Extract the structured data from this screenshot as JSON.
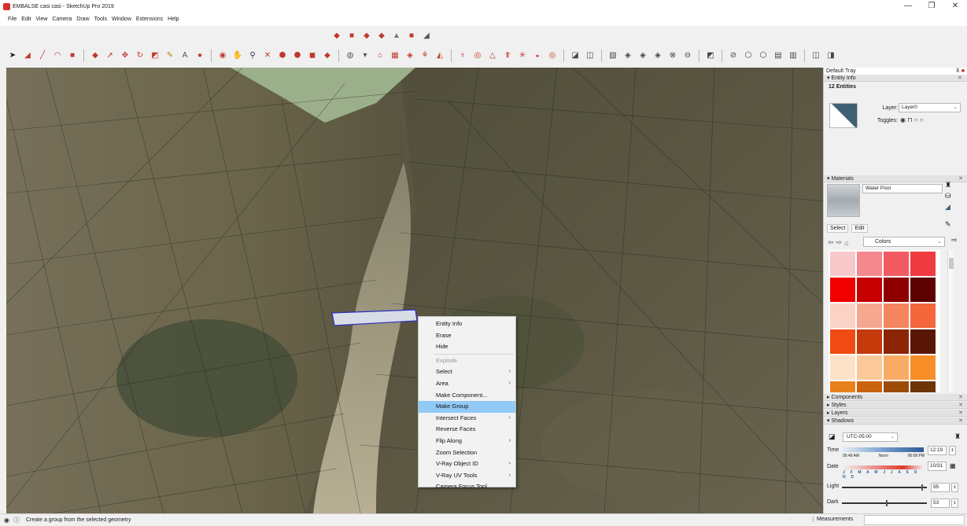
{
  "window": {
    "title": "EMBALSE casi casi - SketchUp Pro 2019",
    "controls": [
      "—",
      "❐",
      "✕"
    ]
  },
  "menubar": [
    "File",
    "Edit",
    "View",
    "Camera",
    "Draw",
    "Tools",
    "Window",
    "Extensions",
    "Help"
  ],
  "context_menu": {
    "items": [
      {
        "label": "Entity Info"
      },
      {
        "label": "Erase"
      },
      {
        "label": "Hide"
      },
      {
        "separator": true
      },
      {
        "label": "Explode",
        "disabled": true
      },
      {
        "label": "Select",
        "submenu": true
      },
      {
        "label": "Area",
        "submenu": true
      },
      {
        "label": "Make Component..."
      },
      {
        "label": "Make Group",
        "highlighted": true
      },
      {
        "label": "Intersect Faces",
        "submenu": true
      },
      {
        "label": "Reverse Faces"
      },
      {
        "label": "Flip Along",
        "submenu": true
      },
      {
        "label": "Zoom Selection"
      },
      {
        "label": "V-Ray Object ID",
        "submenu": true
      },
      {
        "label": "V-Ray UV Tools",
        "submenu": true
      },
      {
        "label": "Camera Focus Tool"
      }
    ]
  },
  "tray": {
    "title": "Default Tray",
    "entity_info": {
      "header": "Entity Info",
      "count": "12 Entities",
      "layer_label": "Layer:",
      "layer_value": "Layer0",
      "toggles_label": "Toggles:"
    },
    "materials": {
      "header": "Materials",
      "current_name": "Water Pool",
      "tabs": [
        "Select",
        "Edit"
      ],
      "collection": "Colors",
      "swatches": [
        "#f7c9cb",
        "#f4888d",
        "#f25a61",
        "#f03a41",
        "#f20000",
        "#c60000",
        "#8e0000",
        "#5d0000",
        "#fad2c6",
        "#f6a78f",
        "#f4855f",
        "#f4663b",
        "#f04b12",
        "#c43a0b",
        "#8c2406",
        "#5a1604",
        "#fde2c9",
        "#fbc89a",
        "#f9ab63",
        "#f78e28",
        "#e8811c",
        "#c9630e",
        "#9d4b08",
        "#6d3405"
      ]
    },
    "collapsed_panels": [
      "Components",
      "Styles",
      "Layers"
    ],
    "shadows": {
      "header": "Shadows",
      "timezone": "UTC-05:00",
      "time_label": "Time",
      "time_ticks": [
        "05:49 AM",
        "Noon",
        "06:08 PM"
      ],
      "time_value": "12:19",
      "date_label": "Date",
      "months": "J F M A M J J A S O N D",
      "date_value": "10/31",
      "light_label": "Light",
      "light_value": "95",
      "dark_label": "Dark",
      "dark_value": "53"
    }
  },
  "statusbar": {
    "hint": "Create a group from the selected geometry",
    "measurements_label": "Measurements"
  }
}
